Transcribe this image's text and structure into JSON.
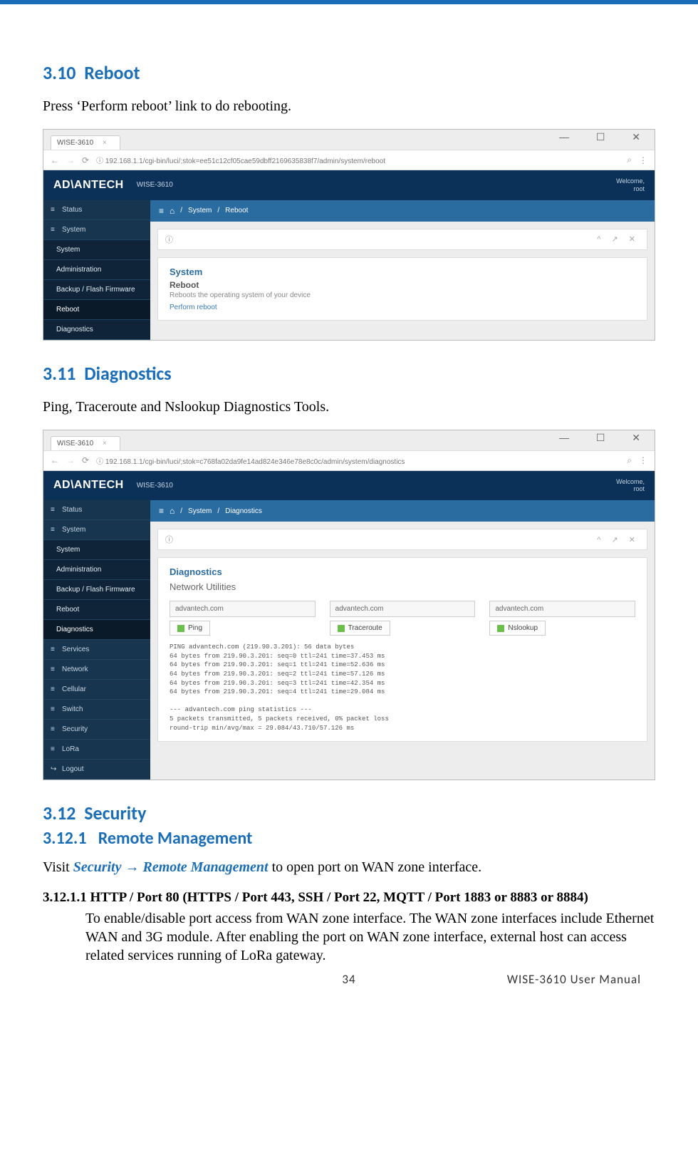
{
  "sections": {
    "s310": {
      "num": "3.10",
      "title": "Reboot",
      "text": "Press ‘Perform reboot’ link to do rebooting."
    },
    "s311": {
      "num": "3.11",
      "title": "Diagnostics",
      "text": "Ping, Traceroute and Nslookup Diagnostics Tools."
    },
    "s312": {
      "num": "3.12",
      "title": "Security"
    },
    "s3121": {
      "num": "3.12.1",
      "title": "Remote Management",
      "visit_pre": "Visit ",
      "visit_path": "Security → Remote Management",
      "visit_post": " to open port on WAN zone interface."
    },
    "s31211": {
      "heading": "3.12.1.1 HTTP / Port 80 (HTTPS / Port 443, SSH / Port 22, MQTT / Port 1883 or 8883 or 8884)",
      "body": "To enable/disable port access from WAN zone interface. The WAN zone interfaces include Ethernet WAN and 3G module. After enabling the port on WAN zone interface, external host can access related services running of LoRa gateway."
    }
  },
  "footer": {
    "page": "34",
    "doc": "WISE-3610  User  Manual"
  },
  "shot1": {
    "tab": "WISE-3610",
    "url": "ⓘ 192.168.1.1/cgi-bin/luci/;stok=ee51c12cf05cae59dbff2169635838f7/admin/system/reboot",
    "logo": "AD\\ANTECH",
    "device": "WISE-3610",
    "welcome1": "Welcome,",
    "welcome2": "root",
    "nav": {
      "status": "Status",
      "system": "System",
      "sub": {
        "system": "System",
        "admin": "Administration",
        "flash": "Backup / Flash Firmware",
        "reboot": "Reboot",
        "diag": "Diagnostics"
      }
    },
    "crumbs": {
      "c1": "System",
      "c2": "Reboot"
    },
    "panel": {
      "title": "System",
      "subtitle": "Reboot",
      "desc": "Reboots the operating system of your device",
      "link": "Perform reboot"
    }
  },
  "shot2": {
    "tab": "WISE-3610",
    "url": "ⓘ 192.168.1.1/cgi-bin/luci/;stok=c768fa02da9fe14ad824e346e78e8c0c/admin/system/diagnostics",
    "logo": "AD\\ANTECH",
    "device": "WISE-3610",
    "welcome1": "Welcome,",
    "welcome2": "root",
    "nav": {
      "status": "Status",
      "system": "System",
      "sub": {
        "system": "System",
        "admin": "Administration",
        "flash": "Backup / Flash Firmware",
        "reboot": "Reboot",
        "diag": "Diagnostics"
      },
      "services": "Services",
      "network": "Network",
      "cellular": "Cellular",
      "switch": "Switch",
      "security": "Security",
      "lora": "LoRa",
      "logout": "Logout"
    },
    "crumbs": {
      "c1": "System",
      "c2": "Diagnostics"
    },
    "panel": {
      "title": "Diagnostics",
      "section": "Network Utilities",
      "host1": "advantech.com",
      "host2": "advantech.com",
      "host3": "advantech.com",
      "btn1": "Ping",
      "btn2": "Traceroute",
      "btn3": "Nslookup",
      "term": "PING advantech.com (219.90.3.201): 56 data bytes\n64 bytes from 219.90.3.201: seq=0 ttl=241 time=37.453 ms\n64 bytes from 219.90.3.201: seq=1 ttl=241 time=52.636 ms\n64 bytes from 219.90.3.201: seq=2 ttl=241 time=57.126 ms\n64 bytes from 219.90.3.201: seq=3 ttl=241 time=42.354 ms\n64 bytes from 219.90.3.201: seq=4 ttl=241 time=29.084 ms\n\n--- advantech.com ping statistics ---\n5 packets transmitted, 5 packets received, 0% packet loss\nround-trip min/avg/max = 29.084/43.710/57.126 ms"
    }
  }
}
